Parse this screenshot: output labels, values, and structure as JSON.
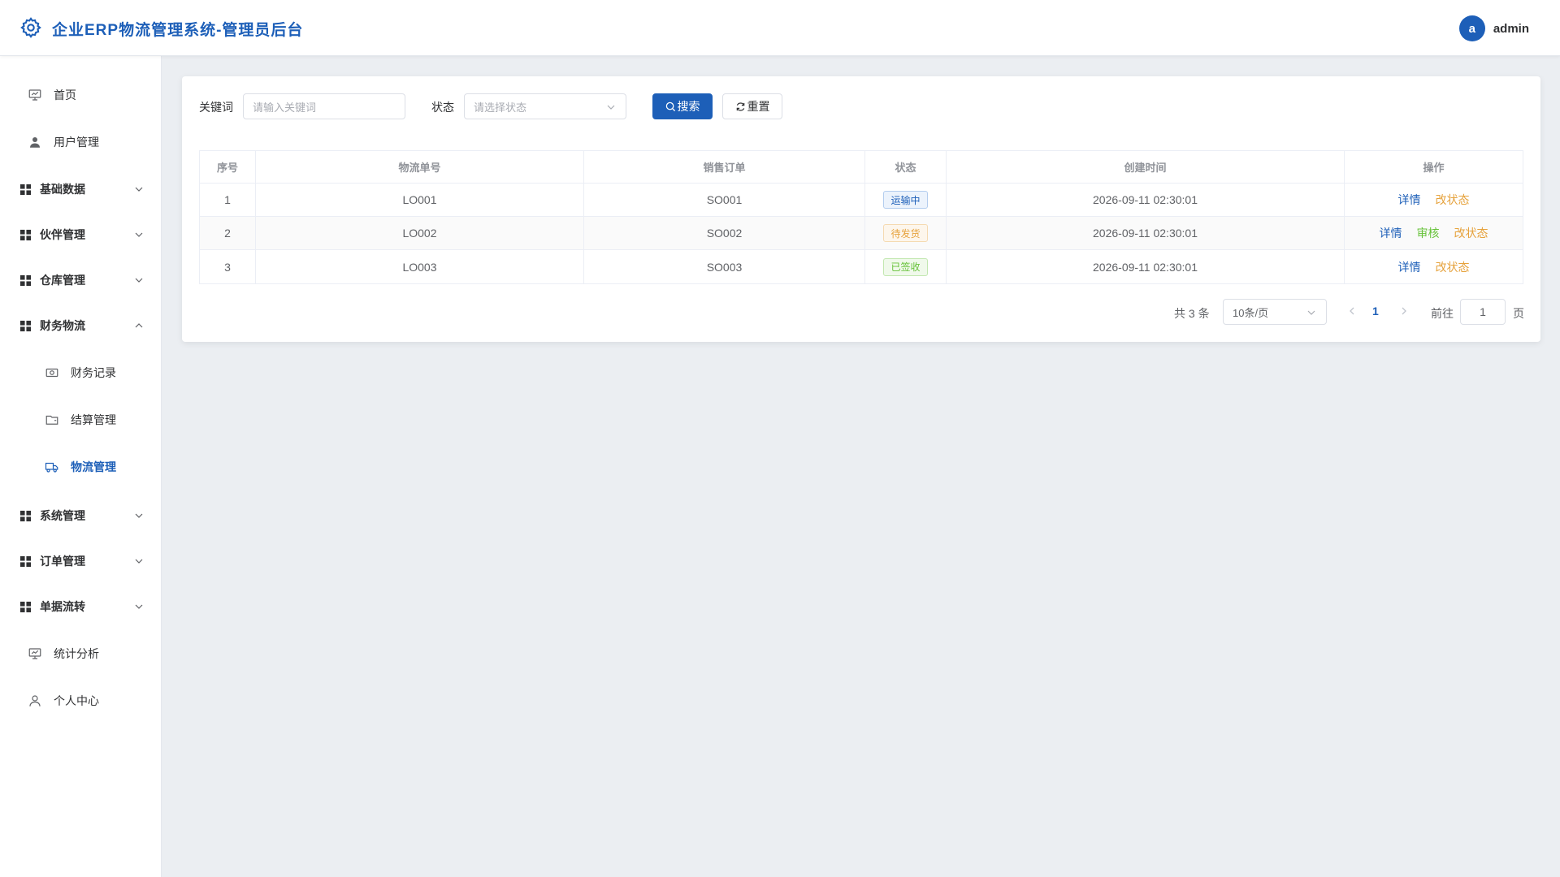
{
  "header": {
    "title": "企业ERP物流管理系统-管理员后台",
    "avatar_letter": "a",
    "user_name": "admin"
  },
  "sidebar": {
    "items": [
      {
        "label": "首页",
        "icon": "monitor-icon"
      },
      {
        "label": "用户管理",
        "icon": "user-icon"
      },
      {
        "label": "基础数据",
        "icon": "grid-icon",
        "expanded": false
      },
      {
        "label": "伙伴管理",
        "icon": "grid-icon",
        "expanded": false
      },
      {
        "label": "仓库管理",
        "icon": "grid-icon",
        "expanded": false
      },
      {
        "label": "财务物流",
        "icon": "grid-icon",
        "expanded": true
      },
      {
        "label": "财务记录",
        "icon": "money-icon"
      },
      {
        "label": "结算管理",
        "icon": "wallet-icon"
      },
      {
        "label": "物流管理",
        "icon": "truck-icon",
        "active": true
      },
      {
        "label": "系统管理",
        "icon": "grid-icon",
        "expanded": false
      },
      {
        "label": "订单管理",
        "icon": "grid-icon",
        "expanded": false
      },
      {
        "label": "单据流转",
        "icon": "grid-icon",
        "expanded": false
      },
      {
        "label": "统计分析",
        "icon": "monitor-icon"
      },
      {
        "label": "个人中心",
        "icon": "user-outline-icon"
      }
    ]
  },
  "filters": {
    "keyword_label": "关键词",
    "keyword_placeholder": "请输入关键词",
    "status_label": "状态",
    "status_placeholder": "请选择状态",
    "search_label": "搜索",
    "reset_label": "重置"
  },
  "table": {
    "headers": [
      "序号",
      "物流单号",
      "销售订单",
      "状态",
      "创建时间",
      "操作"
    ],
    "rows": [
      {
        "index": "1",
        "logistics_no": "LO001",
        "sales_order": "SO001",
        "status": "运输中",
        "created": "2026-09-11 02:30:01",
        "ops": [
          "详情",
          "改状态"
        ]
      },
      {
        "index": "2",
        "logistics_no": "LO002",
        "sales_order": "SO002",
        "status": "待发货",
        "created": "2026-09-11 02:30:01",
        "ops": [
          "详情",
          "审核",
          "改状态"
        ]
      },
      {
        "index": "3",
        "logistics_no": "LO003",
        "sales_order": "SO003",
        "status": "已签收",
        "created": "2026-09-11 02:30:01",
        "ops": [
          "详情",
          "改状态"
        ]
      }
    ]
  },
  "pagination": {
    "total_text": "共 3 条",
    "page_size": "10条/页",
    "current_page": "1",
    "goto_label": "前往",
    "goto_value": "1",
    "page_suffix": "页"
  },
  "colors": {
    "primary": "#1d5fb8",
    "success": "#67c23a",
    "warning": "#e6a23c"
  }
}
